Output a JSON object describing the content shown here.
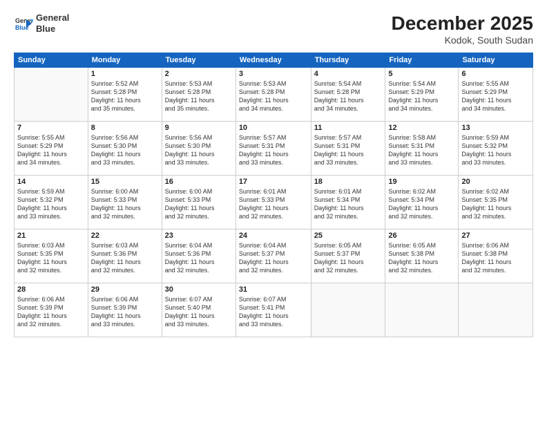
{
  "logo": {
    "line1": "General",
    "line2": "Blue"
  },
  "title": "December 2025",
  "location": "Kodok, South Sudan",
  "weekdays": [
    "Sunday",
    "Monday",
    "Tuesday",
    "Wednesday",
    "Thursday",
    "Friday",
    "Saturday"
  ],
  "weeks": [
    [
      {
        "day": "",
        "info": ""
      },
      {
        "day": "1",
        "info": "Sunrise: 5:52 AM\nSunset: 5:28 PM\nDaylight: 11 hours\nand 35 minutes."
      },
      {
        "day": "2",
        "info": "Sunrise: 5:53 AM\nSunset: 5:28 PM\nDaylight: 11 hours\nand 35 minutes."
      },
      {
        "day": "3",
        "info": "Sunrise: 5:53 AM\nSunset: 5:28 PM\nDaylight: 11 hours\nand 34 minutes."
      },
      {
        "day": "4",
        "info": "Sunrise: 5:54 AM\nSunset: 5:28 PM\nDaylight: 11 hours\nand 34 minutes."
      },
      {
        "day": "5",
        "info": "Sunrise: 5:54 AM\nSunset: 5:29 PM\nDaylight: 11 hours\nand 34 minutes."
      },
      {
        "day": "6",
        "info": "Sunrise: 5:55 AM\nSunset: 5:29 PM\nDaylight: 11 hours\nand 34 minutes."
      }
    ],
    [
      {
        "day": "7",
        "info": "Sunrise: 5:55 AM\nSunset: 5:29 PM\nDaylight: 11 hours\nand 34 minutes."
      },
      {
        "day": "8",
        "info": "Sunrise: 5:56 AM\nSunset: 5:30 PM\nDaylight: 11 hours\nand 33 minutes."
      },
      {
        "day": "9",
        "info": "Sunrise: 5:56 AM\nSunset: 5:30 PM\nDaylight: 11 hours\nand 33 minutes."
      },
      {
        "day": "10",
        "info": "Sunrise: 5:57 AM\nSunset: 5:31 PM\nDaylight: 11 hours\nand 33 minutes."
      },
      {
        "day": "11",
        "info": "Sunrise: 5:57 AM\nSunset: 5:31 PM\nDaylight: 11 hours\nand 33 minutes."
      },
      {
        "day": "12",
        "info": "Sunrise: 5:58 AM\nSunset: 5:31 PM\nDaylight: 11 hours\nand 33 minutes."
      },
      {
        "day": "13",
        "info": "Sunrise: 5:59 AM\nSunset: 5:32 PM\nDaylight: 11 hours\nand 33 minutes."
      }
    ],
    [
      {
        "day": "14",
        "info": "Sunrise: 5:59 AM\nSunset: 5:32 PM\nDaylight: 11 hours\nand 33 minutes."
      },
      {
        "day": "15",
        "info": "Sunrise: 6:00 AM\nSunset: 5:33 PM\nDaylight: 11 hours\nand 32 minutes."
      },
      {
        "day": "16",
        "info": "Sunrise: 6:00 AM\nSunset: 5:33 PM\nDaylight: 11 hours\nand 32 minutes."
      },
      {
        "day": "17",
        "info": "Sunrise: 6:01 AM\nSunset: 5:33 PM\nDaylight: 11 hours\nand 32 minutes."
      },
      {
        "day": "18",
        "info": "Sunrise: 6:01 AM\nSunset: 5:34 PM\nDaylight: 11 hours\nand 32 minutes."
      },
      {
        "day": "19",
        "info": "Sunrise: 6:02 AM\nSunset: 5:34 PM\nDaylight: 11 hours\nand 32 minutes."
      },
      {
        "day": "20",
        "info": "Sunrise: 6:02 AM\nSunset: 5:35 PM\nDaylight: 11 hours\nand 32 minutes."
      }
    ],
    [
      {
        "day": "21",
        "info": "Sunrise: 6:03 AM\nSunset: 5:35 PM\nDaylight: 11 hours\nand 32 minutes."
      },
      {
        "day": "22",
        "info": "Sunrise: 6:03 AM\nSunset: 5:36 PM\nDaylight: 11 hours\nand 32 minutes."
      },
      {
        "day": "23",
        "info": "Sunrise: 6:04 AM\nSunset: 5:36 PM\nDaylight: 11 hours\nand 32 minutes."
      },
      {
        "day": "24",
        "info": "Sunrise: 6:04 AM\nSunset: 5:37 PM\nDaylight: 11 hours\nand 32 minutes."
      },
      {
        "day": "25",
        "info": "Sunrise: 6:05 AM\nSunset: 5:37 PM\nDaylight: 11 hours\nand 32 minutes."
      },
      {
        "day": "26",
        "info": "Sunrise: 6:05 AM\nSunset: 5:38 PM\nDaylight: 11 hours\nand 32 minutes."
      },
      {
        "day": "27",
        "info": "Sunrise: 6:06 AM\nSunset: 5:38 PM\nDaylight: 11 hours\nand 32 minutes."
      }
    ],
    [
      {
        "day": "28",
        "info": "Sunrise: 6:06 AM\nSunset: 5:39 PM\nDaylight: 11 hours\nand 32 minutes."
      },
      {
        "day": "29",
        "info": "Sunrise: 6:06 AM\nSunset: 5:39 PM\nDaylight: 11 hours\nand 33 minutes."
      },
      {
        "day": "30",
        "info": "Sunrise: 6:07 AM\nSunset: 5:40 PM\nDaylight: 11 hours\nand 33 minutes."
      },
      {
        "day": "31",
        "info": "Sunrise: 6:07 AM\nSunset: 5:41 PM\nDaylight: 11 hours\nand 33 minutes."
      },
      {
        "day": "",
        "info": ""
      },
      {
        "day": "",
        "info": ""
      },
      {
        "day": "",
        "info": ""
      }
    ]
  ]
}
